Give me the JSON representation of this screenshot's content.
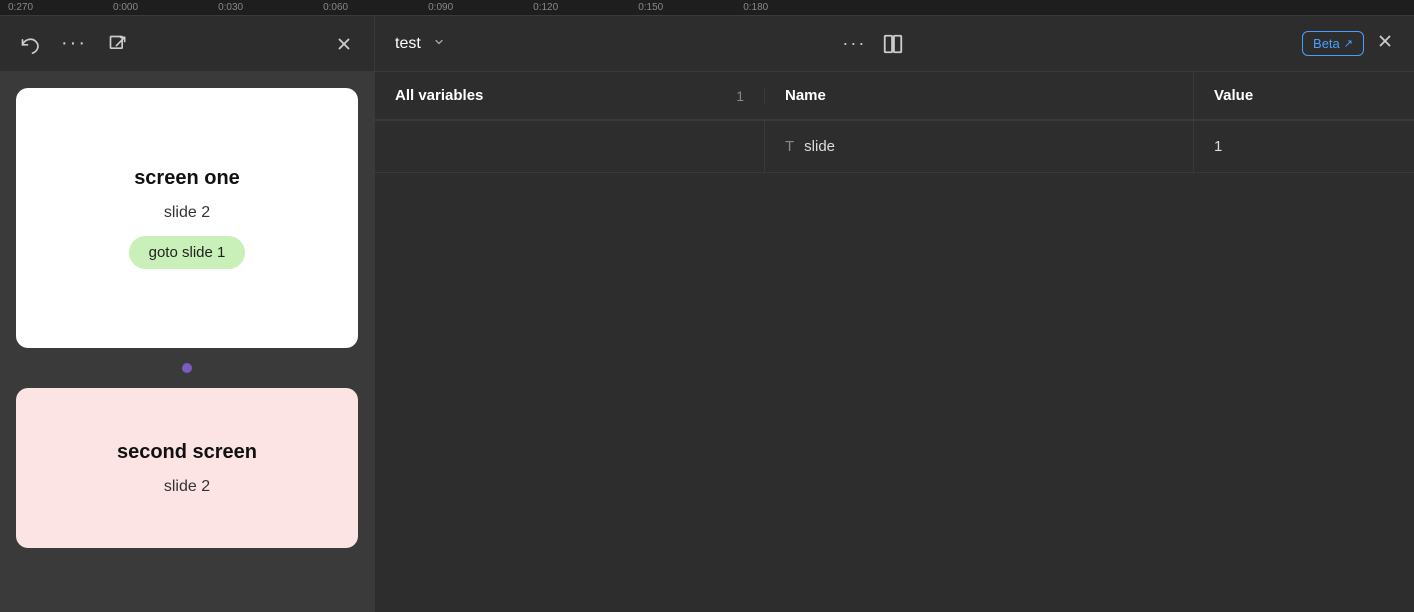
{
  "ruler": {
    "marks": [
      "0:270",
      "0:000",
      "0:030",
      "0:060",
      "0:090",
      "0:120",
      "0:150",
      "0:180"
    ]
  },
  "left_panel": {
    "header": {
      "undo_label": "undo",
      "more_label": "more",
      "external_label": "external-link",
      "close_label": "close"
    },
    "slides": [
      {
        "id": "screen-one",
        "title": "screen one",
        "slide_label": "slide 2",
        "button_label": "goto slide 1",
        "bg": "white"
      },
      {
        "id": "second-screen",
        "title": "second screen",
        "slide_label": "slide 2",
        "bg": "pink"
      }
    ]
  },
  "right_panel": {
    "header": {
      "project_name": "test",
      "beta_label": "Beta",
      "external_icon": "↗"
    },
    "variables_table": {
      "section_label": "All variables",
      "count": "1",
      "col_name": "Name",
      "col_value": "Value",
      "rows": [
        {
          "type_icon": "T",
          "name": "slide",
          "value": "1"
        }
      ]
    }
  }
}
